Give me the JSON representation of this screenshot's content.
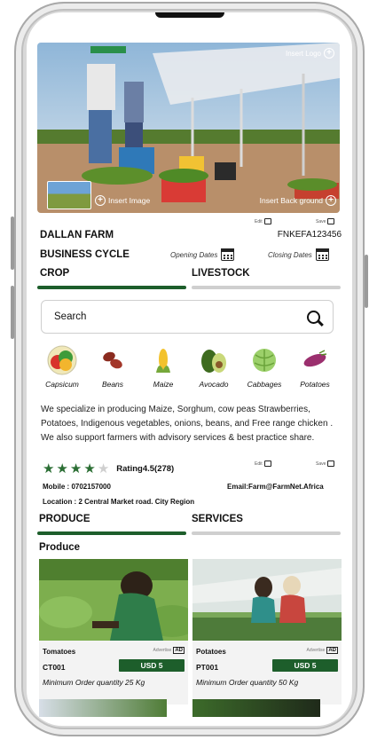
{
  "hero": {
    "top_right_label": "Insert Logo",
    "insert_image_label": "Insert Image",
    "insert_background_label": "Insert Back ground"
  },
  "actions": {
    "edit_label": "Edit",
    "save_label": "Save"
  },
  "farm": {
    "name": "DALLAN FARM",
    "code": "FNKEFA123456",
    "business_cycle_label": "BUSINESS CYCLE",
    "opening_dates_label": "Opening Dates",
    "closing_dates_label": "Closing Dates"
  },
  "tabs_top": [
    {
      "label": "CROP",
      "active": true
    },
    {
      "label": "LIVESTOCK",
      "active": false
    }
  ],
  "search": {
    "placeholder": "Search"
  },
  "crops": [
    {
      "label": "Capsicum",
      "icon": "capsicum-icon"
    },
    {
      "label": "Beans",
      "icon": "beans-icon"
    },
    {
      "label": "Maize",
      "icon": "maize-icon"
    },
    {
      "label": "Avocado",
      "icon": "avocado-icon"
    },
    {
      "label": "Cabbages",
      "icon": "cabbage-icon"
    },
    {
      "label": "Potatoes",
      "icon": "potato-icon"
    }
  ],
  "description": "We specialize in producing Maize, Sorghum, cow peas Strawberries, Potatoes, Indigenous vegetables, onions, beans, and Free range chicken . We also support farmers with advisory services & best practice share.",
  "rating": {
    "stars": 4,
    "max": 5,
    "label": "Rating4.5(278)"
  },
  "contact": {
    "mobile": "Mobile : 0702157000",
    "email": "Email:Farm@FarmNet.Africa",
    "location": "Location : 2 Central Market road. City Region"
  },
  "tabs_bottom": [
    {
      "label": "PRODUCE",
      "active": true
    },
    {
      "label": "SERVICES",
      "active": false
    }
  ],
  "section_title": "Produce",
  "products": [
    {
      "name": "Tomatoes",
      "advertise": "Advertise",
      "ad": "AD",
      "code": "CT001",
      "price": "USD 5",
      "min_order": "Minimum Order quantity 25 Kg"
    },
    {
      "name": "Potatoes",
      "advertise": "Advertise",
      "ad": "AD",
      "code": "PT001",
      "price": "USD 5",
      "min_order": "Minimum Order quantity 50 Kg"
    }
  ],
  "colors": {
    "brand_green": "#1d5e2b",
    "tab_inactive": "#cfcfcf",
    "star_green": "#2b6e34"
  }
}
